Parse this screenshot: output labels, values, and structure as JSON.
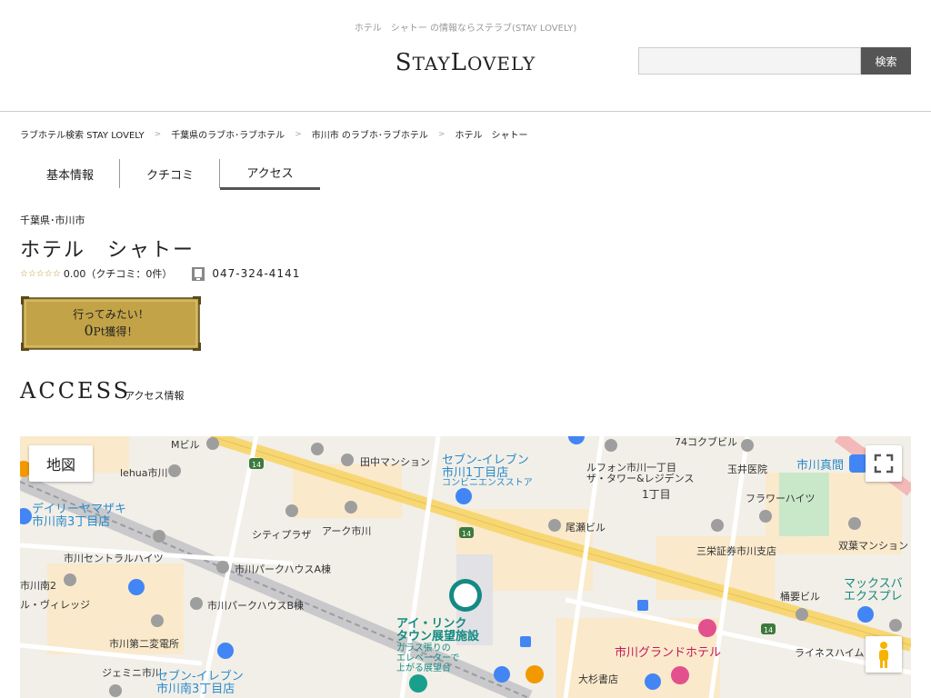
{
  "header": {
    "tagline": "ホテル　シャトー の情報ならステラブ(STAY LOVELY)",
    "logo_text": "STAYLOVELY",
    "logo_parts": [
      "S",
      "TAY",
      "L",
      "OVELY"
    ],
    "search_placeholder": "",
    "search_button": "検索"
  },
  "breadcrumb": [
    "ラブホテル検索 STAY LOVELY",
    "千葉県のラブホ･ラブホテル",
    "市川市 のラブホ･ラブホテル",
    "ホテル　シャトー"
  ],
  "tabs": [
    {
      "label": "基本情報",
      "active": false
    },
    {
      "label": "クチコミ",
      "active": false
    },
    {
      "label": "アクセス",
      "active": true
    }
  ],
  "hotel": {
    "prefecture": "千葉県･市川市",
    "name": "ホテル　シャトー",
    "stars": "☆☆☆☆☆",
    "rating": "0.00（クチコミ：0件）",
    "phone": "047-324-4141"
  },
  "want_button": {
    "line1": "行ってみたい！",
    "points": "0",
    "line2_suffix": "Pt獲得！"
  },
  "access": {
    "title": "ACCESS",
    "subtitle": "アクセス情報"
  },
  "map": {
    "type_button": "地図",
    "labels": [
      {
        "t": "Mビル"
      },
      {
        "t": "田中マンション"
      },
      {
        "t": "セブン-イレブン"
      },
      {
        "t": "市川1丁目店"
      },
      {
        "t": "コンビニエンスストア"
      },
      {
        "t": "74コクブビル"
      },
      {
        "t": "ルフォン市川一丁目"
      },
      {
        "t": "ザ・タワー&レジデンス"
      },
      {
        "t": "1丁目"
      },
      {
        "t": "玉井医院"
      },
      {
        "t": "市川真間"
      },
      {
        "t": "lehua市川"
      },
      {
        "t": "デイリーヤマザキ"
      },
      {
        "t": "市川南3丁目店"
      },
      {
        "t": "シティプラザ"
      },
      {
        "t": "アーク市川"
      },
      {
        "t": "尾瀬ビル"
      },
      {
        "t": "フラワーハイツ"
      },
      {
        "t": "三栄証券市川支店"
      },
      {
        "t": "双葉マンション"
      },
      {
        "t": "市川セントラルハイツ"
      },
      {
        "t": "市川パークハウスA棟"
      },
      {
        "t": "市川南2"
      },
      {
        "t": "ル・ヴィレッジ"
      },
      {
        "t": "市川パークハウスB棟"
      },
      {
        "t": "アイ・リンク"
      },
      {
        "t": "タウン展望施設"
      },
      {
        "t": "ガラス張りの"
      },
      {
        "t": "エレベーターで"
      },
      {
        "t": "上がる展望台"
      },
      {
        "t": "桶要ビル"
      },
      {
        "t": "マックスバ"
      },
      {
        "t": "エクスプレ"
      },
      {
        "t": "市川第二変電所"
      },
      {
        "t": "市川グランドホテル"
      },
      {
        "t": "ライネスハイム"
      },
      {
        "t": "ジェミニ市川"
      },
      {
        "t": "セブン-イレブン"
      },
      {
        "t": "市川南3丁目店"
      },
      {
        "t": "大杉書店"
      },
      {
        "t": "14"
      },
      {
        "t": "14"
      },
      {
        "t": "14"
      }
    ]
  }
}
